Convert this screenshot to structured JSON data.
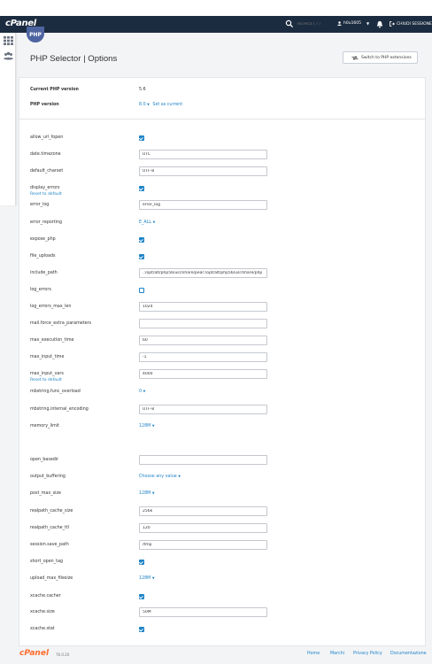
{
  "header": {
    "logo": "cPanel",
    "search_placeholder": "Ricerca ( / )",
    "user": "h0u1605",
    "logout": "CHIUDI SESSIONE"
  },
  "sidebar": {
    "icons": [
      "grid-icon",
      "users-icon"
    ]
  },
  "page": {
    "badge": "PHP",
    "title": "PHP Selector | Options",
    "switch_button": "Switch to PHP extensions"
  },
  "version": {
    "current_label": "Current PHP version",
    "current_value": "5.6",
    "php_label": "PHP version",
    "php_value": "8.0",
    "set_current": "Set as current"
  },
  "options": {
    "allow_url_fopen": {
      "label": "allow_url_fopen",
      "checked": true
    },
    "date_timezone": {
      "label": "date.timezone",
      "value": "UTC"
    },
    "default_charset": {
      "label": "default_charset",
      "value": "UTF-8"
    },
    "display_errors": {
      "label": "display_errors",
      "checked": true,
      "reset": "Reset to default"
    },
    "error_log": {
      "label": "error_log",
      "value": "error_log"
    },
    "error_reporting": {
      "label": "error_reporting",
      "value": "E_ALL"
    },
    "expose_php": {
      "label": "expose_php",
      "checked": true
    },
    "file_uploads": {
      "label": "file_uploads",
      "checked": true
    },
    "include_path": {
      "label": "include_path",
      "value": ".:/opt/alt/php56/usr/share/pear:/opt/alt/php56/usr/share/php"
    },
    "log_errors": {
      "label": "log_errors",
      "checked": false
    },
    "log_errors_max_len": {
      "label": "log_errors_max_len",
      "value": "1024"
    },
    "mail_force_extra_parameters": {
      "label": "mail.force_extra_parameters",
      "value": ""
    },
    "max_execution_time": {
      "label": "max_execution_time",
      "value": "60"
    },
    "max_input_time": {
      "label": "max_input_time",
      "value": "-1"
    },
    "max_input_vars": {
      "label": "max_input_vars",
      "value": "4000",
      "reset": "Reset to default"
    },
    "mbstring_func_overload": {
      "label": "mbstring.func_overload",
      "value": "0"
    },
    "mbstring_internal_encoding": {
      "label": "mbstring.internal_encoding",
      "value": "UTF-8"
    },
    "memory_limit": {
      "label": "memory_limit",
      "value": "128M"
    },
    "open_basedir": {
      "label": "open_basedir",
      "value": ""
    },
    "output_buffering": {
      "label": "output_buffering",
      "value": "Choose any value"
    },
    "post_max_size": {
      "label": "post_max_size",
      "value": "128M"
    },
    "realpath_cache_size": {
      "label": "realpath_cache_size",
      "value": "256k"
    },
    "realpath_cache_ttl": {
      "label": "realpath_cache_ttl",
      "value": "120"
    },
    "session_save_path": {
      "label": "session.save_path",
      "value": "/tmp"
    },
    "short_open_tag": {
      "label": "short_open_tag",
      "checked": true
    },
    "upload_max_filesize": {
      "label": "upload_max_filesize",
      "value": "128M"
    },
    "xcache_cacher": {
      "label": "xcache.cacher",
      "checked": true
    },
    "xcache_size": {
      "label": "xcache.size",
      "value": "50M"
    },
    "xcache_stat": {
      "label": "xcache.stat",
      "checked": true
    }
  },
  "footer": {
    "logo": "cPanel",
    "version": "76.0.20",
    "links": [
      "Home",
      "Marchi",
      "Privacy Policy",
      "Documentazione"
    ]
  },
  "colors": {
    "topbar": "#1c2c40",
    "accent": "#1e84c7",
    "footer_logo": "#ff6c2c"
  }
}
